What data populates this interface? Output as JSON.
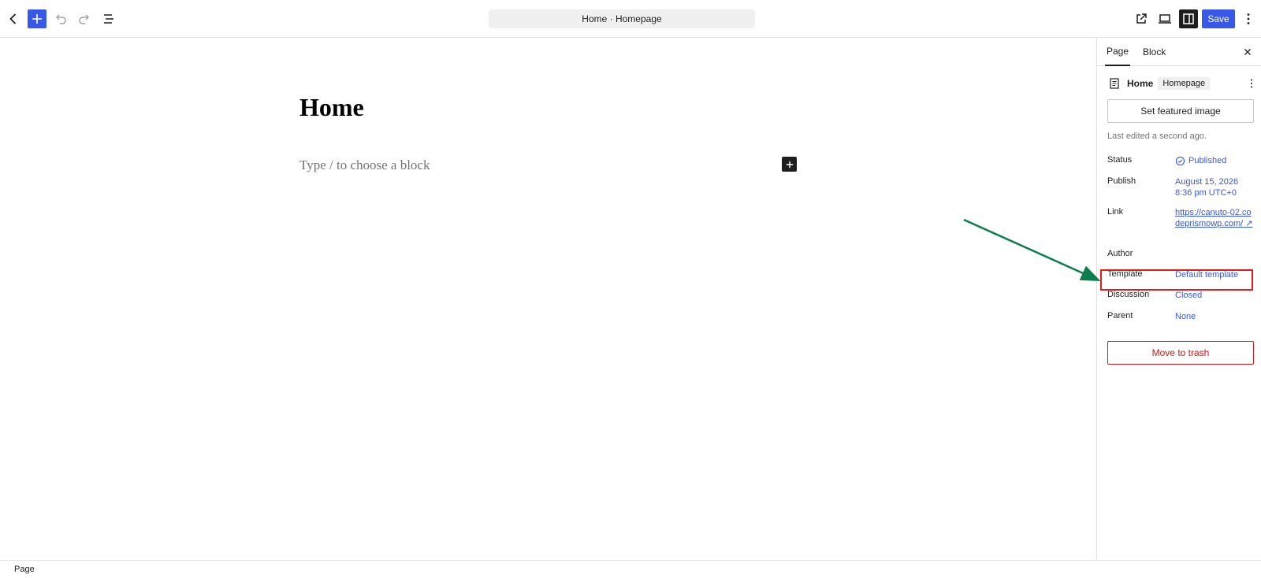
{
  "toolbar": {
    "back_icon": "chevron-left-icon",
    "inserter_icon": "plus-icon",
    "undo_icon": "undo-icon",
    "redo_icon": "redo-icon",
    "list_view_icon": "list-view-icon",
    "document_title": "Home · Homepage",
    "view_external_icon": "external-link-icon",
    "preview_icon": "desktop-icon",
    "settings_icon": "sidebar-toggle-icon",
    "save_label": "Save",
    "options_icon": "kebab-icon",
    "accent_color": "#3858e9"
  },
  "editor": {
    "title": "Home",
    "block_placeholder": "Type / to choose a block"
  },
  "sidebar": {
    "tabs": [
      {
        "label": "Page",
        "active": true
      },
      {
        "label": "Block",
        "active": false
      }
    ],
    "header": {
      "title": "Home",
      "slug": "Homepage"
    },
    "featured_image_label": "Set featured image",
    "last_edited": "Last edited a second ago.",
    "fields": {
      "status": {
        "label": "Status",
        "value": "Published"
      },
      "publish": {
        "label": "Publish",
        "value_line1": "August 15, 2026",
        "value_line2": "8:36 pm UTC+0"
      },
      "link": {
        "label": "Link",
        "value": "https://canuto-02.codeprismowp.com/ ↗"
      },
      "author": {
        "label": "Author",
        "value": ""
      },
      "template": {
        "label": "Template",
        "value": "Default template"
      },
      "discussion": {
        "label": "Discussion",
        "value": "Closed"
      },
      "parent": {
        "label": "Parent",
        "value": "None"
      }
    },
    "trash_label": "Move to trash"
  },
  "footer": {
    "breadcrumb": "Page"
  },
  "annotation": {
    "arrow_color": "#0b7f4b",
    "highlight_color": "#e01c1c"
  }
}
